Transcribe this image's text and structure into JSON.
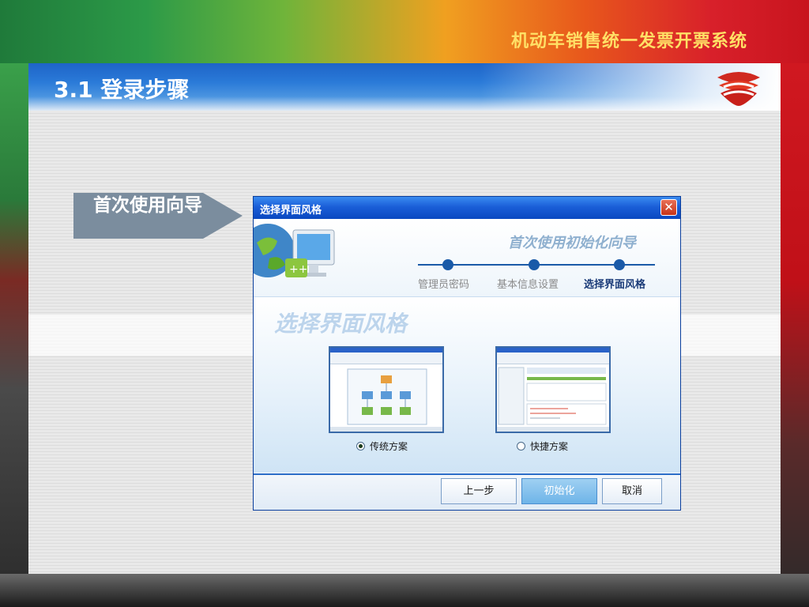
{
  "header": {
    "system_title": "机动车销售统一发票开票系统",
    "section_title": "3.1 登录步骤"
  },
  "callout": {
    "text": "首次使用向导"
  },
  "dialog": {
    "title": "选择界面风格",
    "close_glyph": "✕",
    "banner_heading": "首次使用初始化向导",
    "steps": [
      {
        "label": "管理员密码",
        "active": false
      },
      {
        "label": "基本信息设置",
        "active": false
      },
      {
        "label": "选择界面风格",
        "active": true
      }
    ],
    "watermark": "选择界面风格",
    "options": [
      {
        "label": "传统方案",
        "selected": true
      },
      {
        "label": "快捷方案",
        "selected": false
      }
    ],
    "buttons": {
      "prev": "上一步",
      "init": "初始化",
      "cancel": "取消"
    }
  },
  "colors": {
    "accent_blue": "#1a5aa8",
    "system_title": "#ffe066",
    "titlebar": "#0a48c0"
  },
  "icons": {
    "logo": "heart-stack-logo-icon",
    "close": "close-icon",
    "callout": "arrow-pointer-icon"
  }
}
